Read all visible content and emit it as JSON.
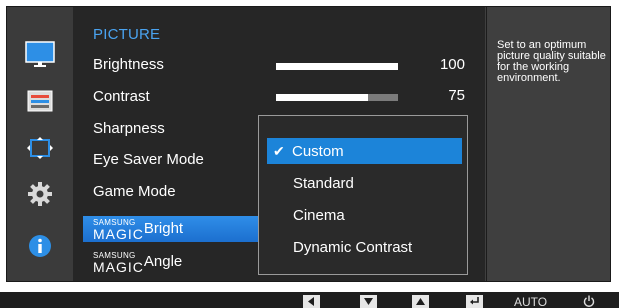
{
  "sidebar": {
    "icons": [
      {
        "name": "picture-icon",
        "selected": true
      },
      {
        "name": "color-icon",
        "selected": false
      },
      {
        "name": "screen-adjustment-icon",
        "selected": false
      },
      {
        "name": "system-gear-icon",
        "selected": false
      },
      {
        "name": "information-icon",
        "selected": false
      }
    ]
  },
  "menu": {
    "title": "PICTURE",
    "items": [
      {
        "label": "Brightness",
        "value": "100",
        "level": 1.0
      },
      {
        "label": "Contrast",
        "value": "75",
        "level": 0.75
      },
      {
        "label": "Sharpness"
      },
      {
        "label": "Eye Saver Mode"
      },
      {
        "label": "Game Mode"
      },
      {
        "brand_small": "SAMSUNG",
        "brand_big": "MAGIC",
        "label": "Bright",
        "selected": true
      },
      {
        "brand_small": "SAMSUNG",
        "brand_big": "MAGIC",
        "label": "Angle"
      }
    ]
  },
  "dropdown": {
    "options": [
      {
        "label": "Custom",
        "selected": true
      },
      {
        "label": "Standard",
        "selected": false
      },
      {
        "label": "Cinema",
        "selected": false
      },
      {
        "label": "Dynamic Contrast",
        "selected": false
      }
    ]
  },
  "help": {
    "text": "Set to an optimum\npicture quality suitable\nfor the working\nenvironment."
  },
  "bottom_bar": {
    "buttons": [
      {
        "name": "left-arrow-icon",
        "glyph": "◀"
      },
      {
        "name": "down-arrow-icon",
        "glyph": "▼"
      },
      {
        "name": "up-arrow-icon",
        "glyph": "▲"
      },
      {
        "name": "enter-icon",
        "glyph": "↵"
      }
    ],
    "auto_label": "AUTO",
    "power_glyph": "⏻"
  },
  "colors": {
    "accent_blue": "#1c84d9",
    "title_blue": "#4aa3f0",
    "panel_dark": "#262626",
    "frame_gray": "#3f3f3f"
  }
}
